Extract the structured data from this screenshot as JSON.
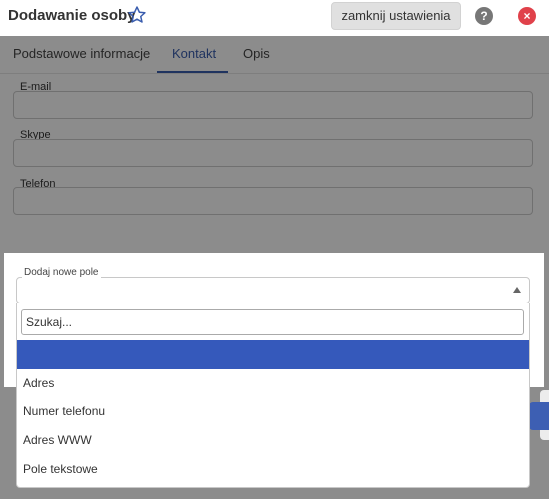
{
  "window": {
    "title": "Dodawanie osoby",
    "close_settings_label": "zamknij ustawienia",
    "help_glyph": "?",
    "close_glyph": "×"
  },
  "tabs": [
    {
      "label": "Podstawowe informacje",
      "active": false
    },
    {
      "label": "Kontakt",
      "active": true
    },
    {
      "label": "Opis",
      "active": false
    }
  ],
  "fields": [
    {
      "label": "E-mail",
      "value": ""
    },
    {
      "label": "Skype",
      "value": ""
    },
    {
      "label": "Telefon",
      "value": ""
    }
  ],
  "add_field": {
    "legend": "Dodaj nowe pole",
    "selected": "",
    "search_placeholder": "Szukaj...",
    "options": [
      "",
      "Adres",
      "Numer telefonu",
      "Adres WWW",
      "Pole tekstowe"
    ],
    "highlighted_index": 0
  },
  "colors": {
    "accent": "#3a5dae",
    "highlight": "#3559bb",
    "close": "#e0414a"
  },
  "icons": {
    "favorite": "star-icon",
    "help": "help-icon",
    "close": "close-icon",
    "dropdown": "caret-up-icon"
  }
}
